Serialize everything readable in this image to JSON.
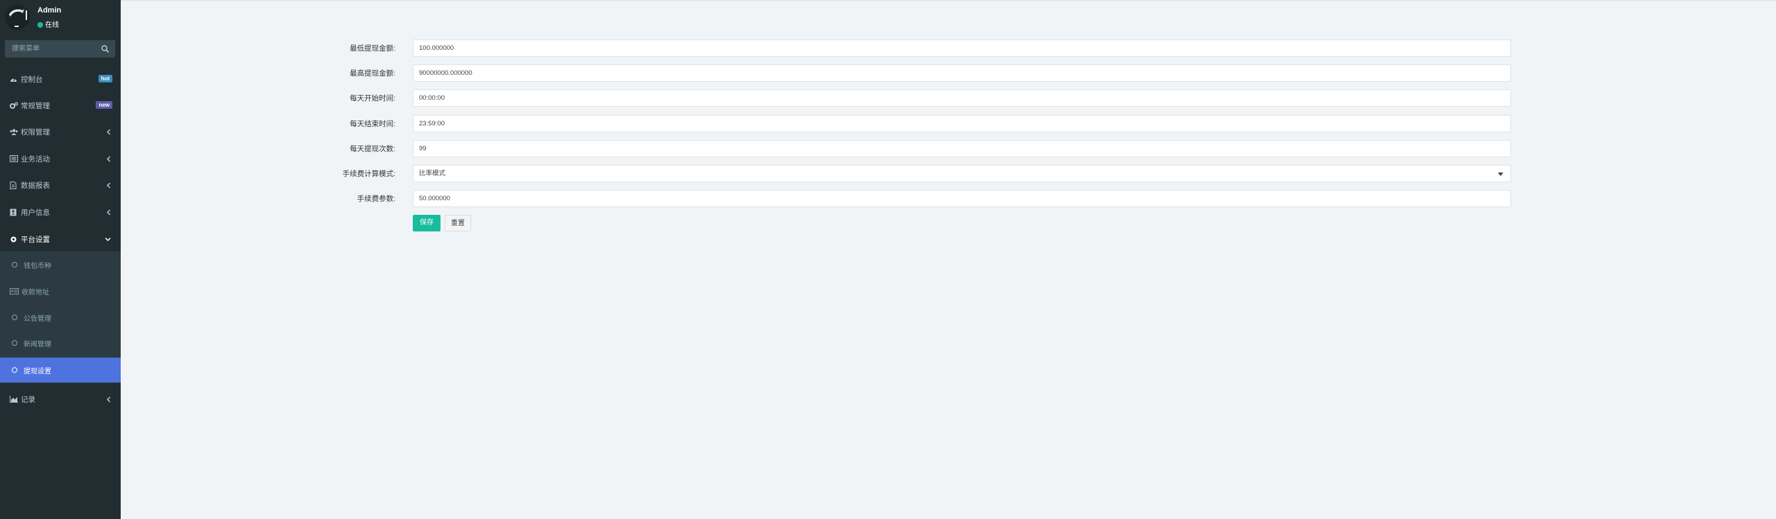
{
  "colors": {
    "sidebar_bg": "#222d32",
    "submenu_bg": "#2c3b41",
    "active": "#4e73df",
    "save": "#18bc9c",
    "online": "#18bc9c"
  },
  "user": {
    "name": "Admin",
    "status": "在线"
  },
  "search": {
    "placeholder": "搜索菜单"
  },
  "sidebar": {
    "items": [
      {
        "label": "控制台",
        "icon": "dashboard-icon",
        "badge": "hot"
      },
      {
        "label": "常规管理",
        "icon": "cogs-icon",
        "badge": "new"
      },
      {
        "label": "权限管理",
        "icon": "users-icon"
      },
      {
        "label": "业务活动",
        "icon": "list-icon"
      },
      {
        "label": "数据报表",
        "icon": "file-icon"
      },
      {
        "label": "用户信息",
        "icon": "address-book-icon"
      },
      {
        "label": "平台设置",
        "icon": "gear-icon",
        "expanded": true
      },
      {
        "label": "记录",
        "icon": "area-chart-icon"
      }
    ],
    "submenu": [
      {
        "label": "钱包币种",
        "icon": "circle-icon"
      },
      {
        "label": "收款地址",
        "icon": "address-card-icon"
      },
      {
        "label": "公告管理",
        "icon": "circle-icon"
      },
      {
        "label": "新闻管理",
        "icon": "circle-icon"
      },
      {
        "label": "提现设置",
        "icon": "circle-icon",
        "active": true
      }
    ]
  },
  "form": {
    "fields": [
      {
        "label": "最低提现金额:",
        "value": "100.000000"
      },
      {
        "label": "最高提现金额:",
        "value": "90000000.000000"
      },
      {
        "label": "每天开始时间:",
        "value": "00:00:00"
      },
      {
        "label": "每天结束时间:",
        "value": "23:59:00"
      },
      {
        "label": "每天提现次数:",
        "value": "99"
      },
      {
        "label": "手续费计算模式:",
        "value": "比率模式",
        "type": "select"
      },
      {
        "label": "手续费参数:",
        "value": "50.000000"
      }
    ],
    "save_label": "保存",
    "reset_label": "重置"
  }
}
